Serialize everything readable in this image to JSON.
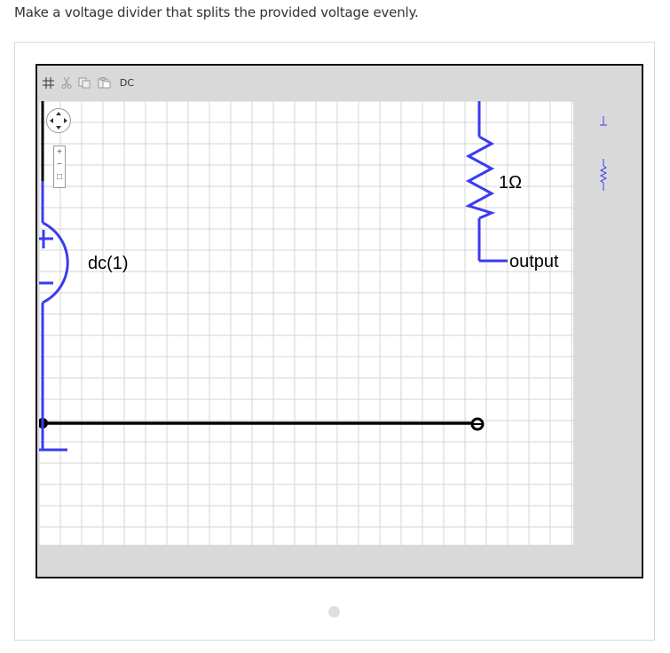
{
  "prompt": "Make a voltage divider that splits the provided voltage evenly.",
  "toolbar": {
    "grid_icon": "grid-icon",
    "cut_icon": "scissors-icon",
    "copy_icon": "copy-icon",
    "paste_icon": "paste-icon",
    "analysis_label": "DC"
  },
  "circuit": {
    "source_label": "dc(1)",
    "resistor_label": "1Ω",
    "port_label": "output"
  },
  "parts_bin": {
    "items": [
      "ground-icon",
      "resistor-icon"
    ]
  },
  "colors": {
    "wire": "#000000",
    "component": "#3b3bef",
    "grid_line": "#d4d4d4",
    "canvas_bg": "#ffffff",
    "editor_bg": "#d9d9d9"
  }
}
